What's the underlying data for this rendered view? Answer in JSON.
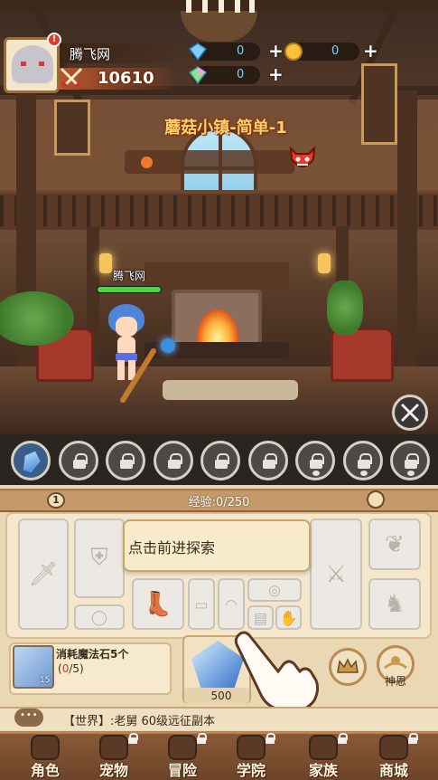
{
  "player": {
    "name": "腾飞网",
    "power": "10610",
    "alert": "!"
  },
  "currencies": [
    {
      "icon": "diamond-icon",
      "value": "0",
      "add": "+"
    },
    {
      "icon": "gold-coin-icon",
      "value": "0",
      "add": "+"
    },
    {
      "icon": "rainbow-gem-icon",
      "value": "0",
      "add": "+"
    }
  ],
  "stage": {
    "title": "蘑菇小镇-简单-1",
    "progress": 0.05,
    "boss_icon": "devil-icon"
  },
  "hero": {
    "name": "腾飞网",
    "hp": 1.0
  },
  "skill_slots": [
    {
      "state": "active",
      "icon": "crystal-icon"
    },
    {
      "state": "locked",
      "icon": "lock-icon"
    },
    {
      "state": "locked",
      "icon": "lock-icon"
    },
    {
      "state": "locked",
      "icon": "lock-icon"
    },
    {
      "state": "locked",
      "icon": "lock-icon"
    },
    {
      "state": "locked",
      "icon": "lock-icon"
    },
    {
      "state": "locked-pet",
      "icon": "paw-lock-icon"
    },
    {
      "state": "locked-pet",
      "icon": "paw-lock-icon"
    },
    {
      "state": "locked-pet",
      "icon": "paw-lock-icon"
    }
  ],
  "level": {
    "value": "1",
    "exp_text": "经验:0/250"
  },
  "equipment": {
    "hint": "点击前进探索",
    "slots": [
      "sword",
      "armor",
      "ring",
      "boots",
      "bracer",
      "helmet",
      "mask",
      "scroll",
      "glove",
      "weapon-special",
      "wing",
      "horse"
    ]
  },
  "quest": {
    "title": "消耗魔法石5个",
    "current": "0",
    "total": "/5",
    "open": "(",
    "close": ")",
    "reward_count": "15"
  },
  "magic_stone": {
    "cost": "500"
  },
  "side_buttons": {
    "grace_label": "神恩"
  },
  "chat": {
    "text": "【世界】:老舅  60级远征副本"
  },
  "nav": [
    {
      "label": "角色",
      "icon": "character-icon",
      "locked": false
    },
    {
      "label": "宠物",
      "icon": "pet-icon",
      "locked": true
    },
    {
      "label": "冒险",
      "icon": "adventure-icon",
      "locked": true
    },
    {
      "label": "学院",
      "icon": "academy-icon",
      "locked": true
    },
    {
      "label": "家族",
      "icon": "family-icon",
      "locked": true
    },
    {
      "label": "商城",
      "icon": "shop-icon",
      "locked": true
    }
  ],
  "colors": {
    "accent": "#ffcf6a",
    "power_bg": "#b8542a",
    "hp": "#4fd63a"
  }
}
